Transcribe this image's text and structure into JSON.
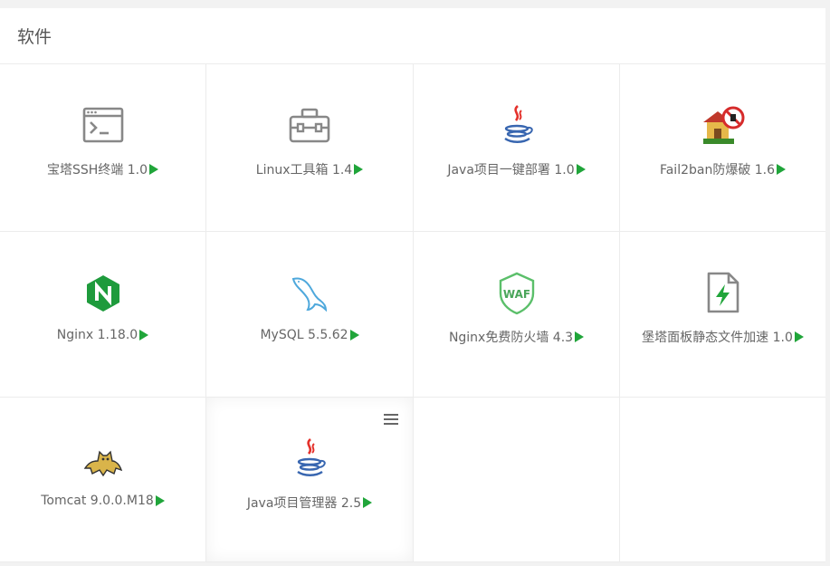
{
  "panel": {
    "title": "软件"
  },
  "apps": [
    {
      "label": "宝塔SSH终端 1.0",
      "icon": "terminal-icon"
    },
    {
      "label": "Linux工具箱 1.4",
      "icon": "toolbox-icon"
    },
    {
      "label": "Java项目一键部署 1.0",
      "icon": "java-icon"
    },
    {
      "label": "Fail2ban防爆破 1.6",
      "icon": "fail2ban-icon"
    },
    {
      "label": "Nginx 1.18.0",
      "icon": "nginx-icon"
    },
    {
      "label": "MySQL 5.5.62",
      "icon": "mysql-dolphin-icon"
    },
    {
      "label": "Nginx免费防火墙 4.3",
      "icon": "waf-shield-icon"
    },
    {
      "label": "堡塔面板静态文件加速 1.0",
      "icon": "file-bolt-icon"
    },
    {
      "label": "Tomcat 9.0.0.M18",
      "icon": "tomcat-icon"
    },
    {
      "label": "Java项目管理器 2.5",
      "icon": "java-icon"
    }
  ],
  "colors": {
    "accent": "#20a53a"
  }
}
